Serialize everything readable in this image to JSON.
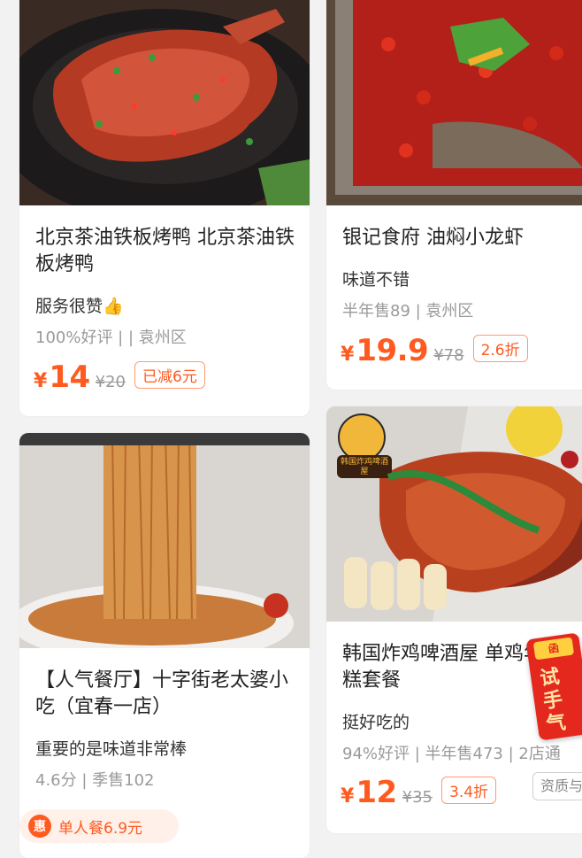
{
  "cards": [
    {
      "title": "北京茶油铁板烤鸭 北京茶油铁板烤鸭",
      "subtitle": "服务很赞👍",
      "meta": "100%好评 |  | 袁州区",
      "price_symbol": "¥",
      "price": "14",
      "original_price": "¥20",
      "tag": "已减6元"
    },
    {
      "title": "银记食府 油焖小龙虾",
      "subtitle": "味道不错",
      "meta": "半年售89 | 袁州区",
      "price_symbol": "¥",
      "price": "19.9",
      "original_price": "¥78",
      "tag": "2.6折"
    },
    {
      "title": "【人气餐厅】十字街老太婆小吃（宜春一店）",
      "subtitle": "重要的是味道非常棒",
      "meta": "4.6分 | 季售102",
      "promo_icon": "惠",
      "promo": "单人餐6.9元"
    },
    {
      "title": "韩国炸鸡啤酒屋 单鸡年糕套餐",
      "subtitle": "挺好吃的",
      "meta": "94%好评 | 半年售473 | 2店通",
      "price_symbol": "¥",
      "price": "12",
      "original_price": "¥35",
      "tag": "3.4折",
      "chip": "资质与",
      "logo_text": "韩国炸鸡啤酒屋"
    }
  ],
  "float_badge": {
    "cap": "函",
    "chars": [
      "试",
      "手",
      "气"
    ]
  }
}
